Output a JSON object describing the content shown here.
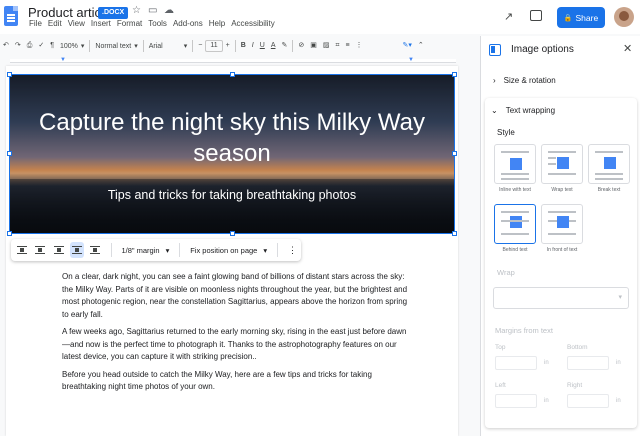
{
  "header": {
    "title": "Product article",
    "badge": ".DOCX",
    "menu": [
      "File",
      "Edit",
      "View",
      "Insert",
      "Format",
      "Tools",
      "Add-ons",
      "Help",
      "Accessibility"
    ],
    "share_label": "Share"
  },
  "toolbar": {
    "zoom": "100%",
    "style": "Normal text",
    "font": "Arial",
    "font_size": "11"
  },
  "hero": {
    "title": "Capture the night sky this Milky Way season",
    "subtitle": "Tips and tricks for taking breathtaking photos"
  },
  "image_toolbar": {
    "margin": "1/8\" margin",
    "position": "Fix position on page"
  },
  "body": {
    "paragraphs": [
      "On a clear, dark night, you can see a faint glowing band of billions of distant stars across the sky: the Milky Way. Parts of it are visible on moonless nights throughout the year, but the brightest and most photogenic region, near the constellation Sagittarius, appears above the horizon from spring to early fall.",
      "A few weeks ago, Sagittarius returned to the early morning sky, rising in the east just before dawn—and now is the perfect time to photograph it. Thanks to the astrophotography features on our latest device, you can capture it with striking precision..",
      "Before you head outside to catch the Milky Way, here are a few tips and tricks for taking breathtaking night time photos of your own."
    ]
  },
  "panel": {
    "title": "Image options",
    "size_rotation": "Size & rotation",
    "text_wrapping": "Text wrapping",
    "style_label": "Style",
    "styles": [
      {
        "label": "Inline with text"
      },
      {
        "label": "Wrap text"
      },
      {
        "label": "Break text"
      },
      {
        "label": "Behind text",
        "selected": true
      },
      {
        "label": "In front of text"
      }
    ],
    "wrap_label": "Wrap",
    "margins_label": "Margins from text",
    "top": "Top",
    "bottom": "Bottom",
    "left": "Left",
    "right": "Right",
    "unit": "in"
  },
  "colors": {
    "accent": "#1a73e8",
    "doc_icon": "#4285f4"
  }
}
